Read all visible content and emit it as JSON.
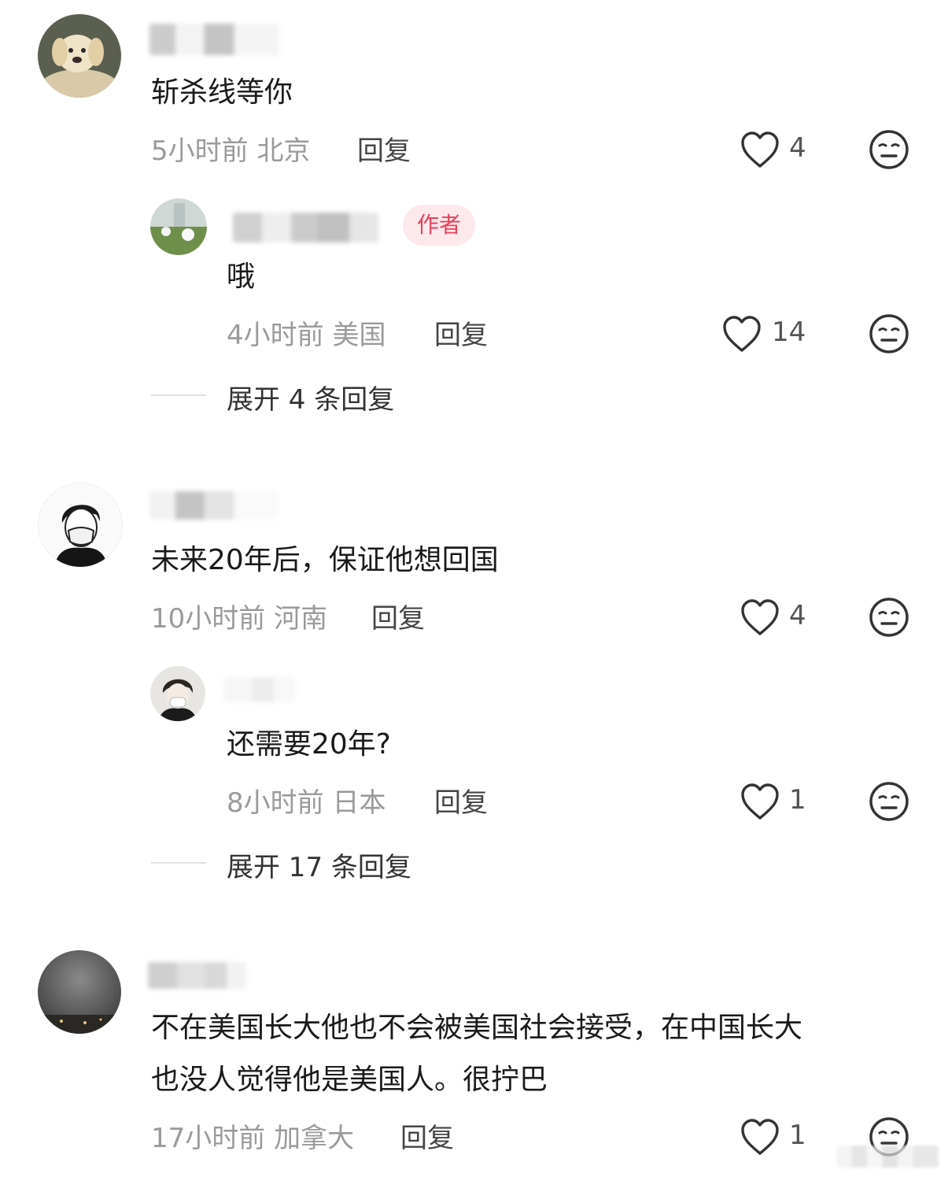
{
  "comments": [
    {
      "text": "斩杀线等你",
      "time": "5小时前",
      "location": "北京",
      "reply_label": "回复",
      "likes": "4",
      "sub": {
        "author_tag": "作者",
        "text": "哦",
        "time": "4小时前",
        "location": "美国",
        "reply_label": "回复",
        "likes": "14"
      },
      "expand_label": "展开 4 条回复"
    },
    {
      "text": "未来20年后，保证他想回国",
      "time": "10小时前",
      "location": "河南",
      "reply_label": "回复",
      "likes": "4",
      "sub": {
        "text": "还需要20年?",
        "time": "8小时前",
        "location": "日本",
        "reply_label": "回复",
        "likes": "1"
      },
      "expand_label": "展开 17 条回复"
    },
    {
      "text_line1": "不在美国长大他也不会被美国社会接受，在中国长大",
      "text_line2": "也没人觉得他是美国人。很拧巴",
      "time": "17小时前",
      "location": "加拿大",
      "reply_label": "回复",
      "likes": "1"
    }
  ],
  "icons": {
    "like": "heart-outline-icon",
    "dislike": "neutral-face-icon"
  },
  "colors": {
    "author_tag_bg": "#fde8ec",
    "author_tag_text": "#e8425a",
    "meta_text": "#9a9a9a"
  }
}
